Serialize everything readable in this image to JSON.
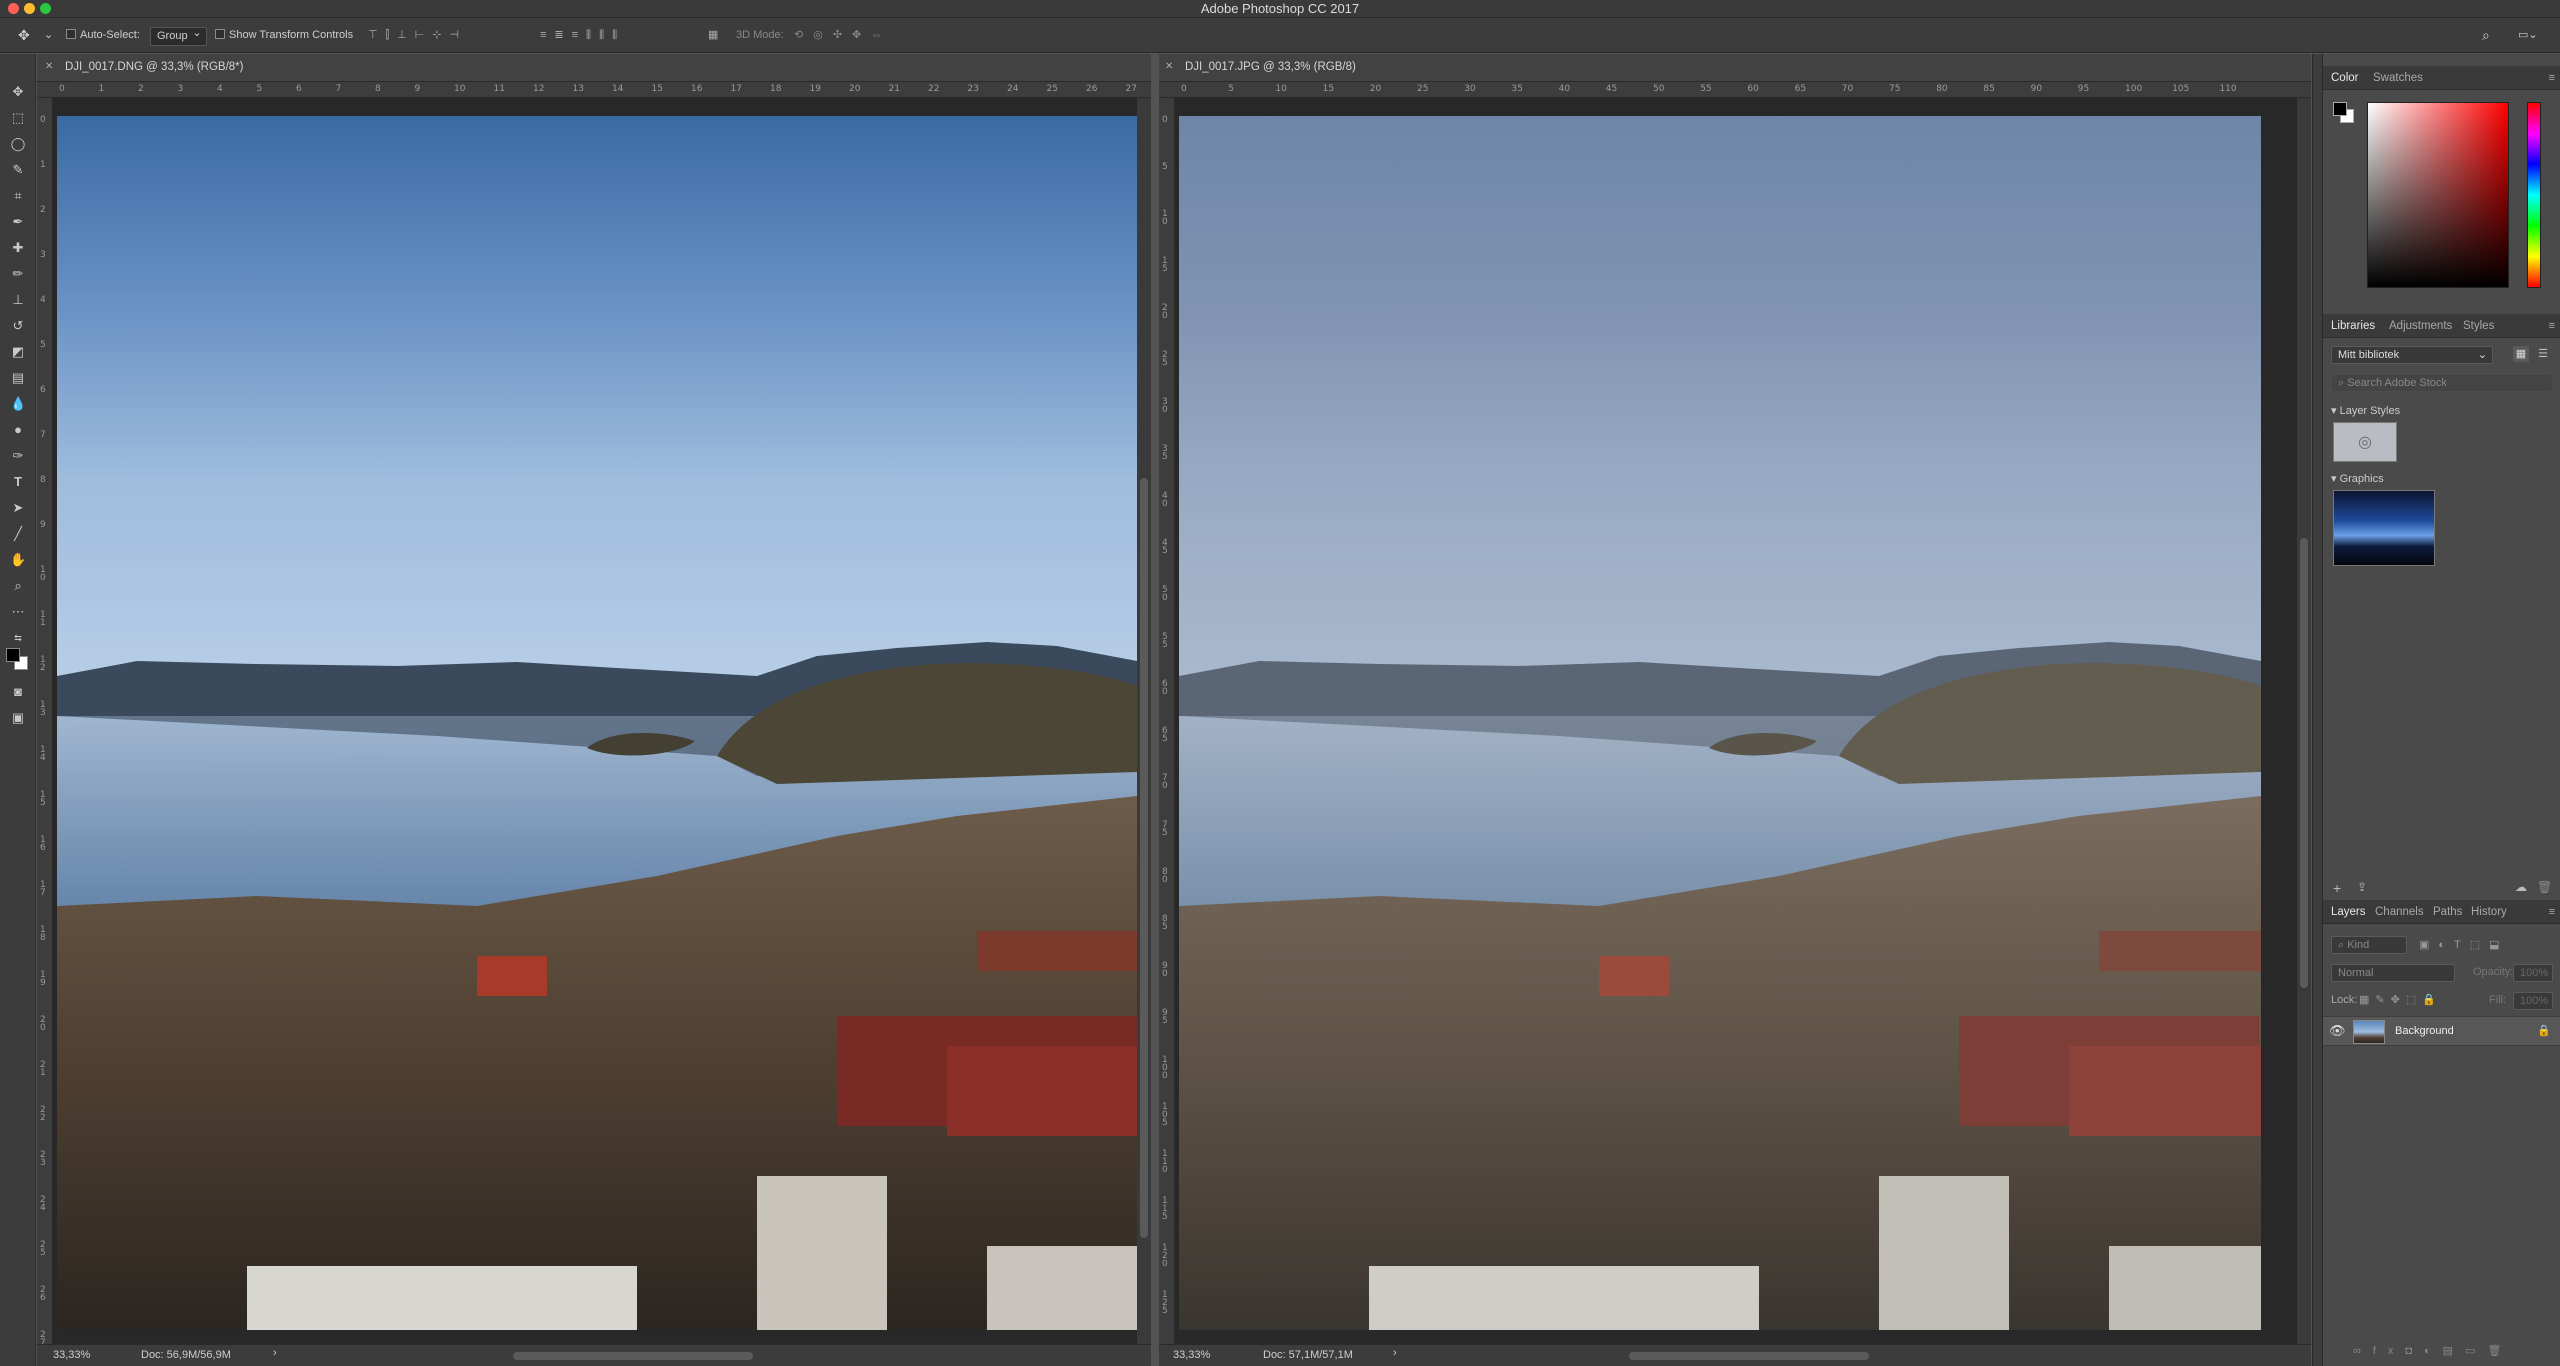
{
  "app": {
    "title": "Adobe Photoshop CC 2017"
  },
  "options_bar": {
    "auto_select_label": "Auto-Select:",
    "auto_select_value": "Group",
    "transform_label": "Show Transform Controls",
    "mode_3d_label": "3D Mode:"
  },
  "documents": [
    {
      "tab_title": "DJI_0017.DNG @ 33,3% (RGB/8*)",
      "zoom": "33,33%",
      "doc_info": "Doc: 56,9M/56,9M",
      "ruler_top": [
        "0",
        "1",
        "2",
        "3",
        "4",
        "5",
        "6",
        "7",
        "8",
        "9",
        "10",
        "11",
        "12",
        "13",
        "14",
        "15",
        "16",
        "17",
        "18",
        "19",
        "20",
        "21",
        "22",
        "23",
        "24",
        "25",
        "26",
        "27"
      ],
      "ruler_left": [
        "0",
        "1",
        "2",
        "3",
        "4",
        "5",
        "6",
        "7",
        "8",
        "9",
        "1 0",
        "1 1",
        "1 2",
        "1 3",
        "1 4",
        "1 5",
        "1 6",
        "1 7",
        "1 8",
        "1 9",
        "2 0",
        "2 1",
        "2 2",
        "2 3",
        "2 4",
        "2 5",
        "2 6",
        "2 7"
      ]
    },
    {
      "tab_title": "DJI_0017.JPG @ 33,3% (RGB/8)",
      "zoom": "33,33%",
      "doc_info": "Doc: 57,1M/57,1M",
      "ruler_top": [
        "0",
        "5",
        "10",
        "15",
        "20",
        "25",
        "30",
        "35",
        "40",
        "45",
        "50",
        "55",
        "60",
        "65",
        "70",
        "75",
        "80",
        "85",
        "90",
        "95",
        "100",
        "105",
        "110"
      ],
      "ruler_left": [
        "0",
        "5",
        "1 0",
        "1 5",
        "2 0",
        "2 5",
        "3 0",
        "3 5",
        "4 0",
        "4 5",
        "5 0",
        "5 5",
        "6 0",
        "6 5",
        "7 0",
        "7 5",
        "8 0",
        "8 5",
        "9 0",
        "9 5",
        "1 0 0",
        "1 0 5",
        "1 1 0",
        "1 1 5",
        "1 2 0",
        "1 2 5"
      ]
    }
  ],
  "color_panel": {
    "tabs": [
      "Color",
      "Swatches"
    ],
    "active_tab": "Color",
    "foreground": "#000000",
    "background": "#ffffff"
  },
  "libraries_panel": {
    "tabs": [
      "Libraries",
      "Adjustments",
      "Styles"
    ],
    "active_tab": "Libraries",
    "library_name": "Mitt bibliotek",
    "search_placeholder": "Search Adobe Stock",
    "sections": [
      {
        "label": "Layer Styles"
      },
      {
        "label": "Graphics"
      }
    ]
  },
  "layers_panel": {
    "tabs": [
      "Layers",
      "Channels",
      "Paths",
      "History"
    ],
    "active_tab": "Layers",
    "filter_label": "Kind",
    "blend_mode": "Normal",
    "opacity_label": "Opacity:",
    "opacity_value": "100%",
    "lock_label": "Lock:",
    "fill_label": "Fill:",
    "fill_value": "100%",
    "layers": [
      {
        "name": "Background",
        "visible": true,
        "locked": true
      }
    ]
  },
  "colors": {
    "ui_dark": "#3c3c3c",
    "panel": "#4a4a4a",
    "accent_red": "#ff5f57",
    "accent_yellow": "#febc2e",
    "accent_green": "#28c840"
  }
}
